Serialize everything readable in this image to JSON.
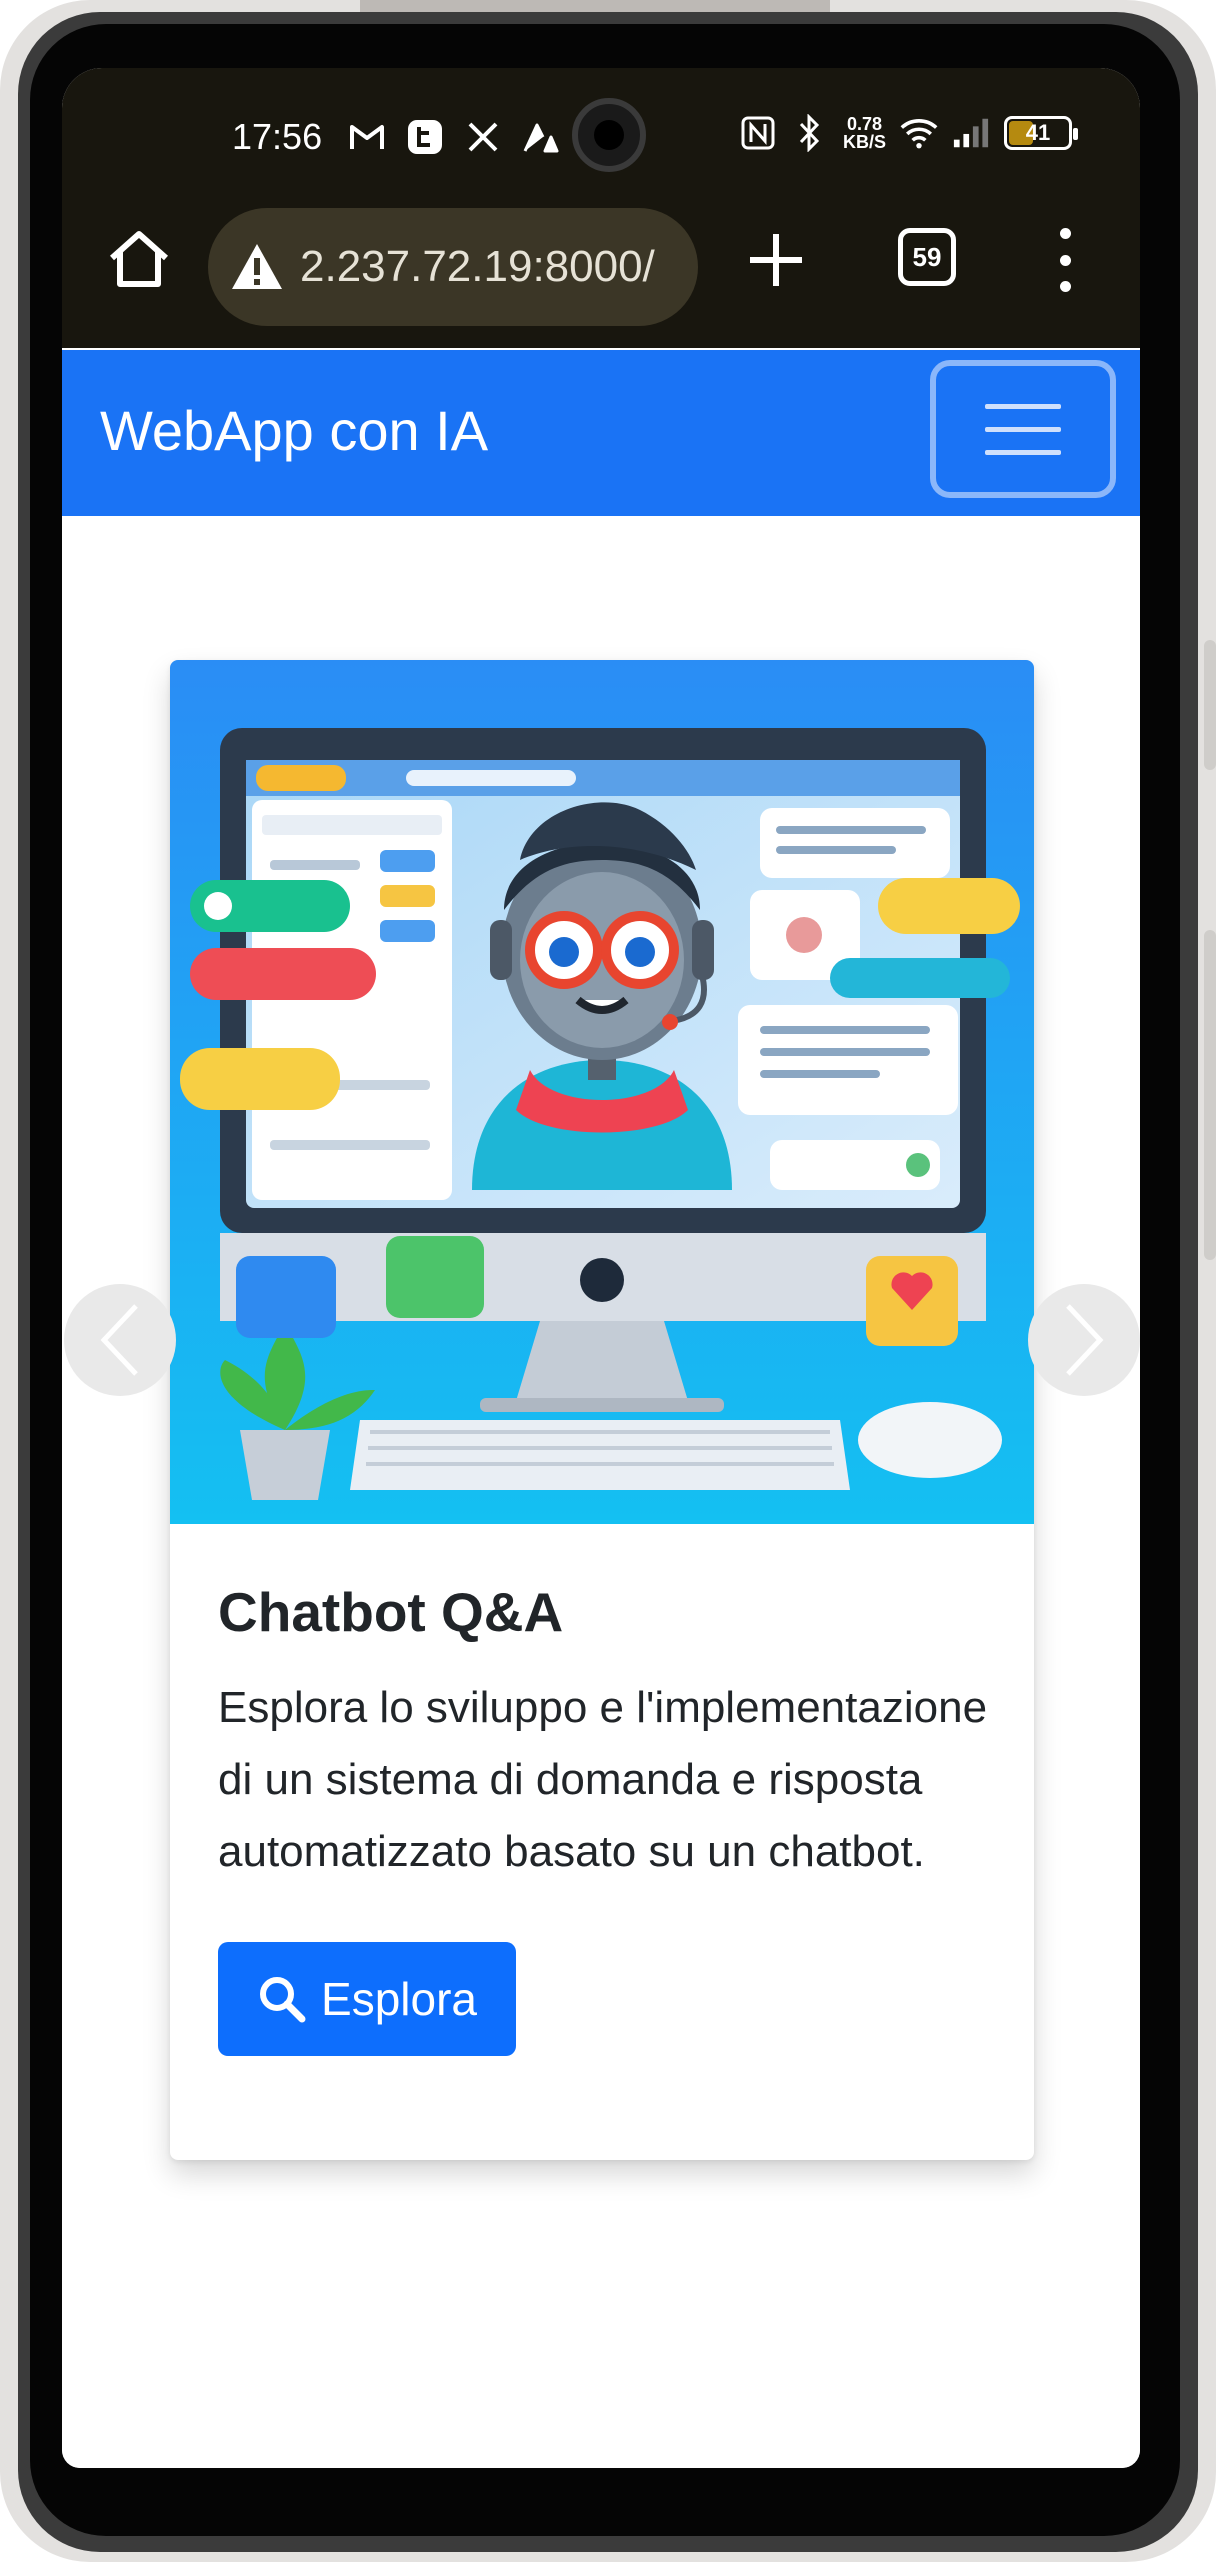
{
  "status_bar": {
    "time": "17:56",
    "net_speed": "0.78",
    "net_unit": "KB/S",
    "battery": "41"
  },
  "browser": {
    "url": "2.237.72.19:8000/",
    "tab_count": "59"
  },
  "navbar": {
    "brand": "WebApp con IA"
  },
  "card": {
    "title": "Chatbot Q&A",
    "text": "Esplora lo sviluppo e l'implementazione di un sistema di domanda e risposta automatizzato basato su un chatbot.",
    "button_label": "Esplora"
  },
  "colors": {
    "navbar": "#1a73f5",
    "button": "#0d6efd",
    "browser_chrome": "#18160e"
  }
}
